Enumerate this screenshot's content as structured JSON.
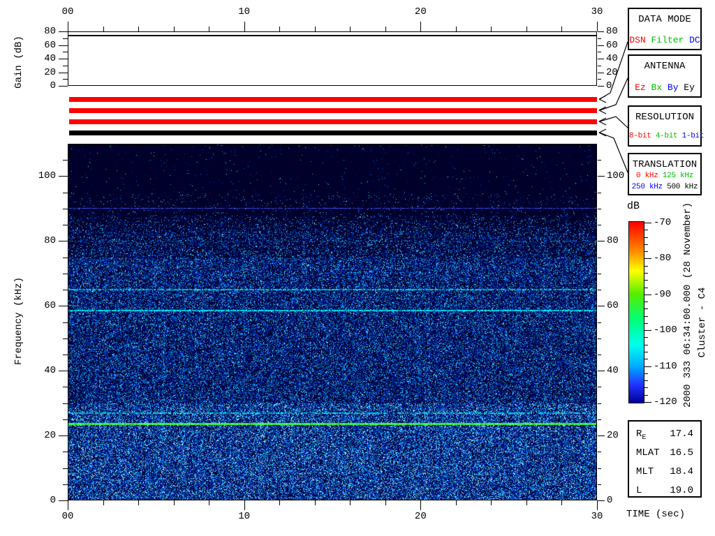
{
  "axes": {
    "time": {
      "xlabel": "TIME (sec)",
      "labels": [
        "00",
        "10",
        "20",
        "30"
      ],
      "major_ticks_sec": [
        0,
        10,
        20,
        30
      ],
      "minor_step_sec": 2,
      "range_sec": [
        0,
        30
      ]
    },
    "frequency": {
      "ylabel": "Frequency (kHz)",
      "labels": [
        "0",
        "20",
        "40",
        "60",
        "80",
        "100"
      ],
      "major_step_khz": 20,
      "minor_step_khz": 5,
      "range_khz": [
        0,
        110
      ]
    },
    "gain": {
      "ylabel": "Gain (dB)",
      "labels": [
        "0",
        "20",
        "40",
        "60",
        "80"
      ],
      "major_step_db": 20,
      "minor_step_db": 10,
      "range_db": [
        0,
        80
      ]
    },
    "colorbar": {
      "title": "dB",
      "labels": [
        "-70",
        "-80",
        "-90",
        "-100",
        "-110",
        "-120"
      ],
      "major_step_db": 10,
      "minor_step_db": 2,
      "range_db": [
        -120,
        -70
      ]
    }
  },
  "side_text": {
    "datetime": "2000 333 06:34:00.000 (28 November)",
    "spacecraft": "Cluster - C4"
  },
  "boxes": {
    "data_mode": {
      "title": "DATA MODE",
      "options": [
        {
          "label": "DSN",
          "color": "#ff0000"
        },
        {
          "label": "Filter",
          "color": "#00bb00"
        },
        {
          "label": "DC",
          "color": "#0000ff"
        }
      ]
    },
    "antenna": {
      "title": "ANTENNA",
      "options": [
        {
          "label": "Ez",
          "color": "#ff0000"
        },
        {
          "label": "Bx",
          "color": "#00bb00"
        },
        {
          "label": "By",
          "color": "#0000ff"
        },
        {
          "label": "Ey",
          "color": "#000000"
        }
      ]
    },
    "resolution": {
      "title": "RESOLUTION",
      "options": [
        {
          "label": "8-bit",
          "color": "#ff0000"
        },
        {
          "label": "4-bit",
          "color": "#00bb00"
        },
        {
          "label": "1-bit",
          "color": "#0000ff"
        }
      ]
    },
    "translation": {
      "title": "TRANSLATION",
      "options_line1": [
        {
          "label": "0 kHz",
          "color": "#ff0000"
        },
        {
          "label": "125 kHz",
          "color": "#00bb00"
        }
      ],
      "options_line2": [
        {
          "label": "250 kHz",
          "color": "#0000ff"
        },
        {
          "label": "500 kHz",
          "color": "#000000"
        }
      ]
    }
  },
  "status_bars": {
    "colors": [
      "#ff0000",
      "#ff0000",
      "#ff0000",
      "#000000"
    ]
  },
  "ephemeris": {
    "rows": [
      {
        "label": "R",
        "sub": "E",
        "value": "17.4"
      },
      {
        "label": "MLAT",
        "sub": "",
        "value": "16.5"
      },
      {
        "label": "MLT",
        "sub": "",
        "value": "18.4"
      },
      {
        "label": "L",
        "sub": "",
        "value": "19.0"
      }
    ]
  },
  "chart_data": {
    "type": "heatmap",
    "title": "2000 333 06:34:00.000 (28 November)  Cluster - C4",
    "xlabel": "TIME (sec)",
    "ylabel": "Frequency (kHz)",
    "xlim": [
      0,
      30
    ],
    "ylim": [
      0,
      110
    ],
    "x_ticks": [
      0,
      10,
      20,
      30
    ],
    "y_ticks": [
      0,
      20,
      40,
      60,
      80,
      100
    ],
    "colorbar": {
      "label": "dB",
      "min": -120,
      "max": -70,
      "gradient_top_to_bottom": [
        "#ff0000",
        "#ff8800",
        "#ffff00",
        "#55ee00",
        "#00ff77",
        "#00ffee",
        "#00aaff",
        "#2233ff",
        "#000099"
      ]
    },
    "gain_panel": {
      "ylabel": "Gain (dB)",
      "ylim": [
        0,
        80
      ],
      "trace_db": 75,
      "trace_shape": "constant"
    },
    "noise_ceiling_khz": 83,
    "background": "broadband blue speckle noise, denser and brighter below ~75 kHz, darkest above ~85 kHz",
    "spectral_lines": [
      {
        "khz": 90,
        "color": [
          70,
          80,
          255
        ],
        "width": 1,
        "solidity": 0.8,
        "note": "faint blue line"
      },
      {
        "khz": 80,
        "color": [
          0,
          150,
          210
        ],
        "width": 1,
        "solidity": 0.3,
        "note": "very faint broken line"
      },
      {
        "khz": 65,
        "color": [
          0,
          205,
          230
        ],
        "width": 2,
        "solidity": 0.75,
        "note": "cyan line"
      },
      {
        "khz": 58.5,
        "color": [
          0,
          225,
          255
        ],
        "width": 2,
        "solidity": 0.92,
        "note": "bright cyan line"
      },
      {
        "khz": 27,
        "color": [
          0,
          215,
          220
        ],
        "width": 2,
        "solidity": 0.65,
        "note": "broken cyan line"
      },
      {
        "khz": 23.5,
        "color": [
          70,
          255,
          70
        ],
        "width": 3,
        "solidity": 1.0,
        "note": "solid bright green line"
      }
    ],
    "status_bars": [
      {
        "color": "#ff0000",
        "links_to": "DATA MODE"
      },
      {
        "color": "#ff0000",
        "links_to": "ANTENNA"
      },
      {
        "color": "#ff0000",
        "links_to": "RESOLUTION"
      },
      {
        "color": "#000000",
        "links_to": "TRANSLATION"
      }
    ],
    "ephemeris": {
      "R_E": 17.4,
      "MLAT": 16.5,
      "MLT": 18.4,
      "L": 19.0
    }
  }
}
